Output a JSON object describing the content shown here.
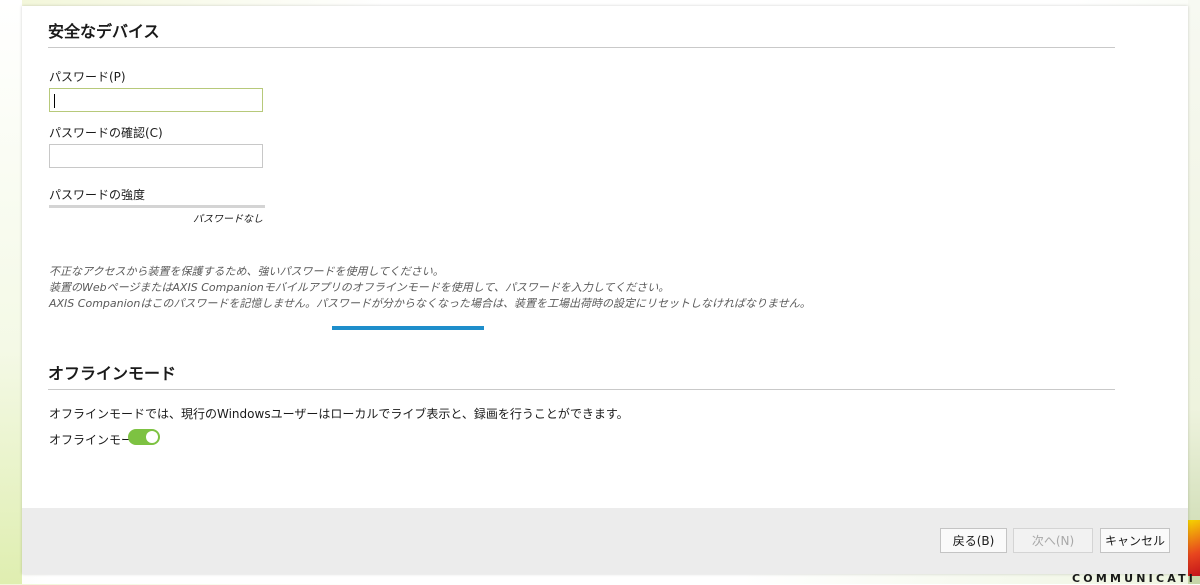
{
  "secure_device": {
    "title": "安全なデバイス",
    "password_label": "パスワード(P)",
    "password_value": "",
    "confirm_label": "パスワードの確認(C)",
    "confirm_value": "",
    "strength_label": "パスワードの強度",
    "strength_text": "パスワードなし",
    "strength_level": 0
  },
  "info_lines": [
    "不正なアクセスから装置を保護するため、強いパスワードを使用してください。",
    "装置のWebページまたはAXIS Companionモバイルアプリのオフラインモードを使用して、パスワードを入力してください。",
    "AXIS Companionはこのパスワードを記憶しません。パスワードが分からなくなった場合は、装置を工場出荷時の設定にリセットしなければなりません。"
  ],
  "offline_mode": {
    "title": "オフラインモード",
    "description": "オフラインモードでは、現行のWindowsユーザーはローカルでライブ表示と、録画を行うことができます。",
    "toggle_label": "オフラインモード",
    "toggle_on": true
  },
  "footer": {
    "back_label": "戻る(B)",
    "next_label": "次へ(N)",
    "cancel_label": "キャンセル"
  },
  "brand": {
    "text": "COMMUNICATI"
  },
  "colors": {
    "accent_blue": "#1e8ecb",
    "toggle_green": "#7dc242"
  }
}
